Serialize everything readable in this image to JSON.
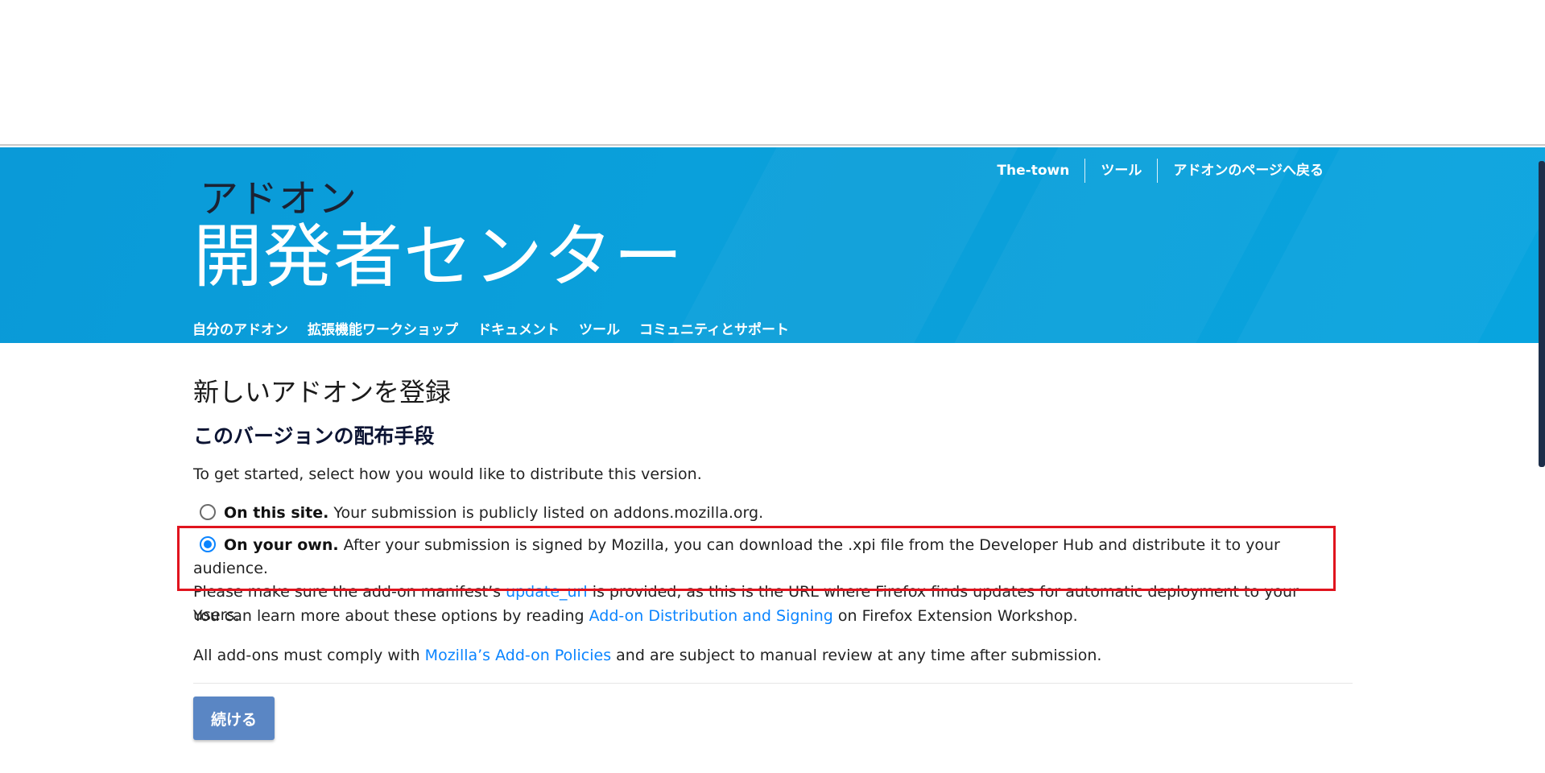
{
  "header": {
    "links": [
      "The-town",
      "ツール",
      "アドオンのページへ戻る"
    ],
    "logo_small": "アドオン",
    "logo_big": "開発者センター",
    "nav": [
      "自分のアドオン",
      "拡張機能ワークショップ",
      "ドキュメント",
      "ツール",
      "コミュニティとサポート"
    ]
  },
  "main": {
    "page_title": "新しいアドオンを登録",
    "section_title": "このバージョンの配布手段",
    "intro": "To get started, select how you would like to distribute this version.",
    "option_site": {
      "label": "On this site.",
      "description": "Your submission is publicly listed on addons.mozilla.org.",
      "selected": false
    },
    "option_own": {
      "label": "On your own.",
      "description_1": "After your submission is signed by Mozilla, you can download the .xpi file from the Developer Hub and distribute it to your audience.",
      "description_2_pre": "Please make sure the add-on manifest’s",
      "link": "update_url",
      "description_2_post": "is provided, as this is the URL where Firefox finds updates for automatic deployment to your users.",
      "selected": true
    },
    "learn_more_pre": "You can learn more about these options by reading",
    "learn_more_link": "Add-on Distribution and Signing",
    "learn_more_post": "on Firefox Extension Workshop.",
    "policy_pre": "All add-ons must comply with",
    "policy_link": "Mozilla’s Add-on Policies",
    "policy_post": "and are subject to manual review at any time after submission.",
    "continue_label": "続ける"
  },
  "colors": {
    "header_bg": "#0a9ad8",
    "link": "#0a84ff",
    "button": "#5a86c4",
    "highlight": "#e0141e"
  }
}
